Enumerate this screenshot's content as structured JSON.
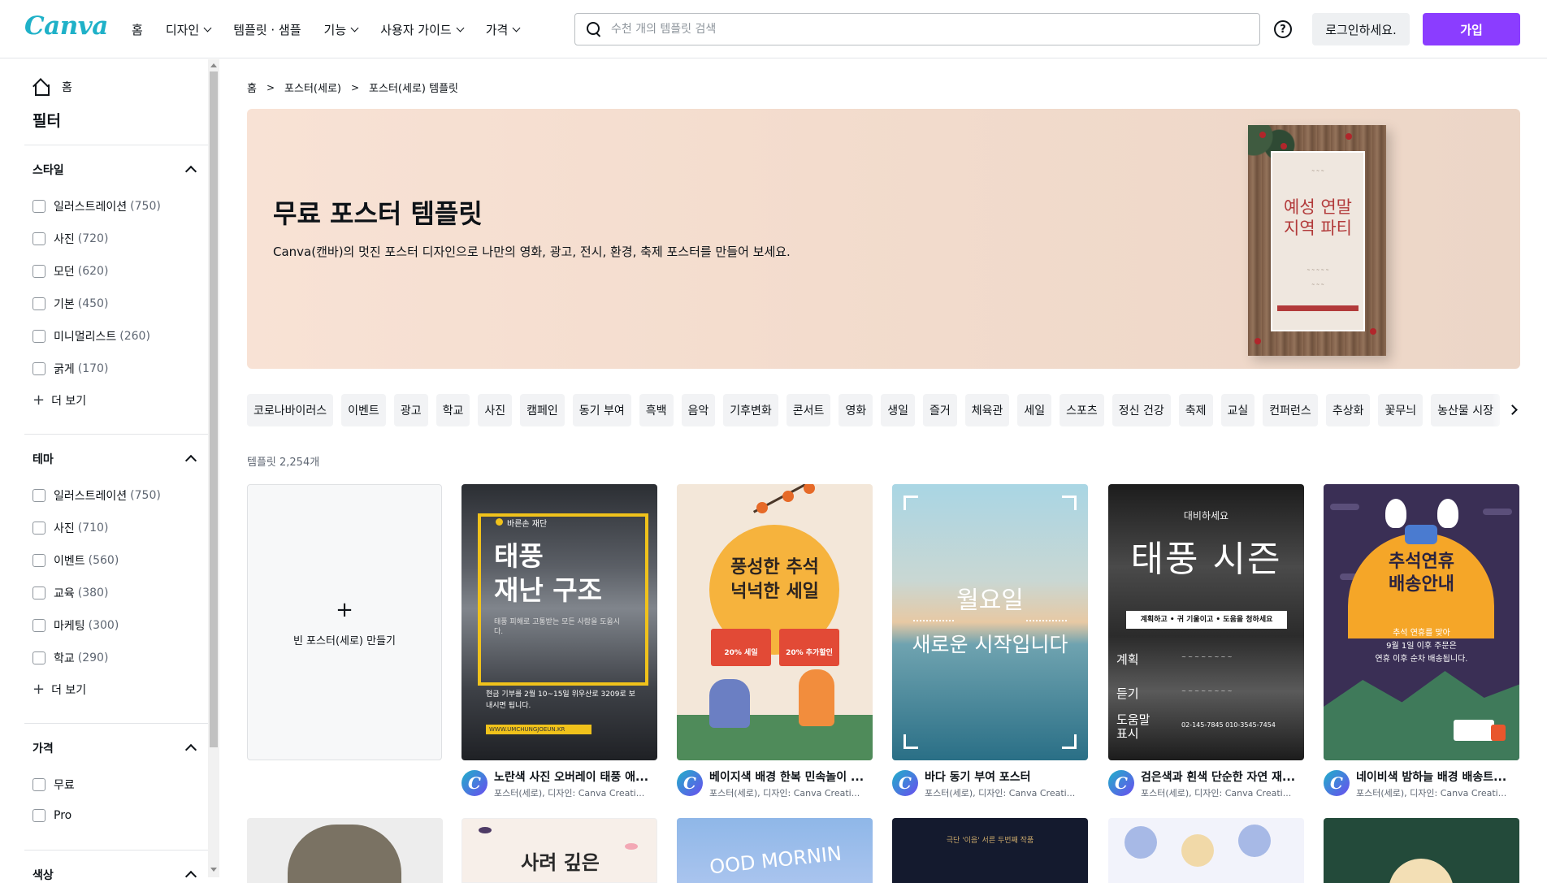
{
  "header": {
    "logo": "Canva",
    "nav": [
      {
        "label": "홈",
        "has_menu": false
      },
      {
        "label": "디자인",
        "has_menu": true
      },
      {
        "label": "템플릿 · 샘플",
        "has_menu": false
      },
      {
        "label": "기능",
        "has_menu": true
      },
      {
        "label": "사용자 가이드",
        "has_menu": true
      },
      {
        "label": "가격",
        "has_menu": true
      }
    ],
    "search_placeholder": "수천 개의 템플릿 검색",
    "help_icon": "?",
    "login_label": "로그인하세요.",
    "join_label": "가입",
    "accent_color": "#8b3dff"
  },
  "sidebar": {
    "home_label": "홈",
    "filter_title": "필터",
    "sections": [
      {
        "title": "스타일",
        "options": [
          {
            "label": "일러스트레이션",
            "count": "(750)"
          },
          {
            "label": "사진",
            "count": "(720)"
          },
          {
            "label": "모던",
            "count": "(620)"
          },
          {
            "label": "기본",
            "count": "(450)"
          },
          {
            "label": "미니멀리스트",
            "count": "(260)"
          },
          {
            "label": "굵게",
            "count": "(170)"
          }
        ],
        "more_label": "더 보기"
      },
      {
        "title": "테마",
        "options": [
          {
            "label": "일러스트레이션",
            "count": "(750)"
          },
          {
            "label": "사진",
            "count": "(710)"
          },
          {
            "label": "이벤트",
            "count": "(560)"
          },
          {
            "label": "교육",
            "count": "(380)"
          },
          {
            "label": "마케팅",
            "count": "(300)"
          },
          {
            "label": "학교",
            "count": "(290)"
          }
        ],
        "more_label": "더 보기"
      },
      {
        "title": "가격",
        "options": [
          {
            "label": "무료",
            "count": ""
          },
          {
            "label": "Pro",
            "count": ""
          }
        ]
      },
      {
        "title": "색상"
      }
    ]
  },
  "breadcrumb": [
    "홈",
    "포스터(세로)",
    "포스터(세로) 템플릿"
  ],
  "hero": {
    "title": "무료 포스터 템플릿",
    "description": "Canva(캔바)의 멋진 포스터 디자인으로 나만의 영화, 광고, 전시, 환경, 축제 포스터를 만들어 보세요.",
    "poster_title_line1": "예성 연말",
    "poster_title_line2": "지역 파티"
  },
  "chips": [
    "코로나바이러스",
    "이벤트",
    "광고",
    "학교",
    "사진",
    "캠페인",
    "동기 부여",
    "흑백",
    "음악",
    "기후변화",
    "콘서트",
    "영화",
    "생일",
    "즐거",
    "체육관",
    "세일",
    "스포츠",
    "정신 건강",
    "축제",
    "교실",
    "컨퍼런스",
    "추상화",
    "꽃무늬",
    "농산물 시장"
  ],
  "template_count": "템플릿 2,254개",
  "blank_card": {
    "plus": "+",
    "label": "빈 포스터(세로) 만들기"
  },
  "templates": [
    {
      "name": "노란색 사진 오버레이 태풍 애...",
      "sub": "포스터(세로), 디자인: Canva Creati...",
      "tag": "바른손 재단",
      "heading_line1": "태풍",
      "heading_line2": "재난 구조",
      "body": "태풍 피해로 고통받는 모든 사람을 도웁시다.",
      "footer": "현금 기부를 2월 10~15일 위우산로 3209로 보내시면 됩니다.",
      "url": "WWW.UMCHUNGJOEUN.KR"
    },
    {
      "name": "베이지색 배경 한복 민속놀이 ...",
      "sub": "포스터(세로), 디자인: Canva Creati...",
      "heading_line1": "풍성한 추석",
      "heading_line2": "넉넉한 세일",
      "badge1": "20% 세일",
      "badge2": "20% 추가할인"
    },
    {
      "name": "바다 동기 부여 포스터",
      "sub": "포스터(세로), 디자인: Canva Creati...",
      "heading_line1": "월요일",
      "heading_line2": "새로운 시작입니다"
    },
    {
      "name": "검은색과 흰색 단순한 자연 재...",
      "sub": "포스터(세로), 디자인: Canva Creati...",
      "top": "대비하세요",
      "heading": "태풍 시즌",
      "bar": "계획하고 • 귀 기울이고 • 도움을 청하세요",
      "k1": "계획",
      "k2": "듣기",
      "k3_line1": "도움말",
      "k3_line2": "표시",
      "phone": "02-145-7845 010-3545-7454"
    },
    {
      "name": "네이비색 밤하늘 배경 배송트...",
      "sub": "포스터(세로), 디자인: Canva Creati...",
      "heading_line1": "추석연휴",
      "heading_line2": "배송안내",
      "body_line1": "추석 연휴를 맞아",
      "body_line2": "9월 1일 이후 주문은",
      "body_line3": "연휴 이후 순차 배송됩니다."
    }
  ],
  "row2": {
    "b_heading": "사려 깊은",
    "c_heading": "OOD MORNIN",
    "d_heading": "극단 '이음' 서른 두번째 작품"
  }
}
